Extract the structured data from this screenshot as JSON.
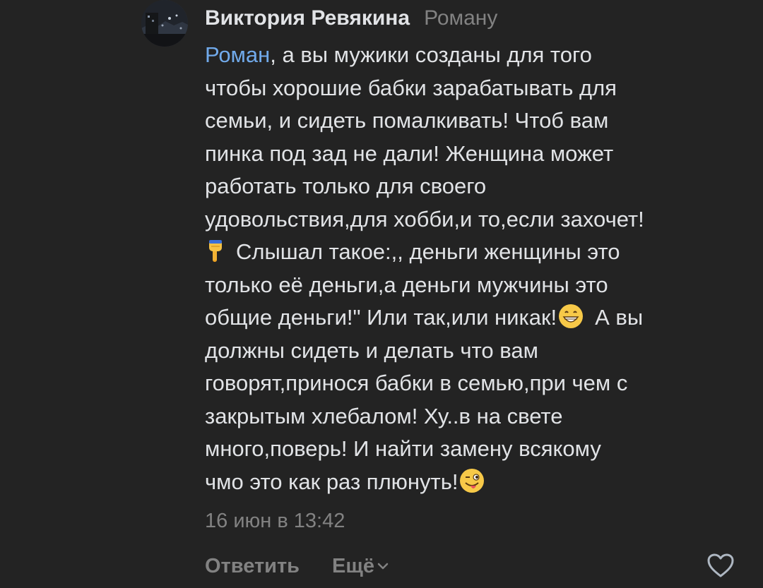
{
  "comment": {
    "author": "Виктория Ревякина",
    "reply_to": "Роману",
    "mention": "Роман",
    "lines": [
      ", а вы мужики созданы для того",
      "чтобы хорошие бабки зарабатывать для",
      "семьи, и сидеть помалкивать! Чтоб вам",
      "пинка под зад не дали! Женщина может",
      "работать только для своего",
      "удовольствия,для хобби,и то,если захочет!",
      "Слышал такое:,, деньги женщины это",
      "только её деньги,а деньги мужчины это",
      "общие деньги!\" Или так,или никак!",
      "А вы",
      "должны сидеть и делать что вам",
      "говорят,принося бабки в семью,при чем с",
      "закрытым хлебалом! Ху..в на свете",
      "много,поверь! И найти замену всякому",
      "чмо это как раз плюнуть!"
    ],
    "emojis": {
      "pointing": "backhand-index-pointing-down-emoji",
      "grin": "grinning-face-emoji",
      "wink": "winking-face-with-tongue-emoji"
    },
    "timestamp": "16 июн в 13:42"
  },
  "actions": {
    "reply_label": "Ответить",
    "more_label": "Ещё",
    "more_icon": "chevron-down-icon",
    "like_icon": "heart-icon"
  },
  "colors": {
    "background": "#232323",
    "text": "#e1e3e6",
    "secondary": "#828282",
    "mention": "#71aaeb"
  }
}
